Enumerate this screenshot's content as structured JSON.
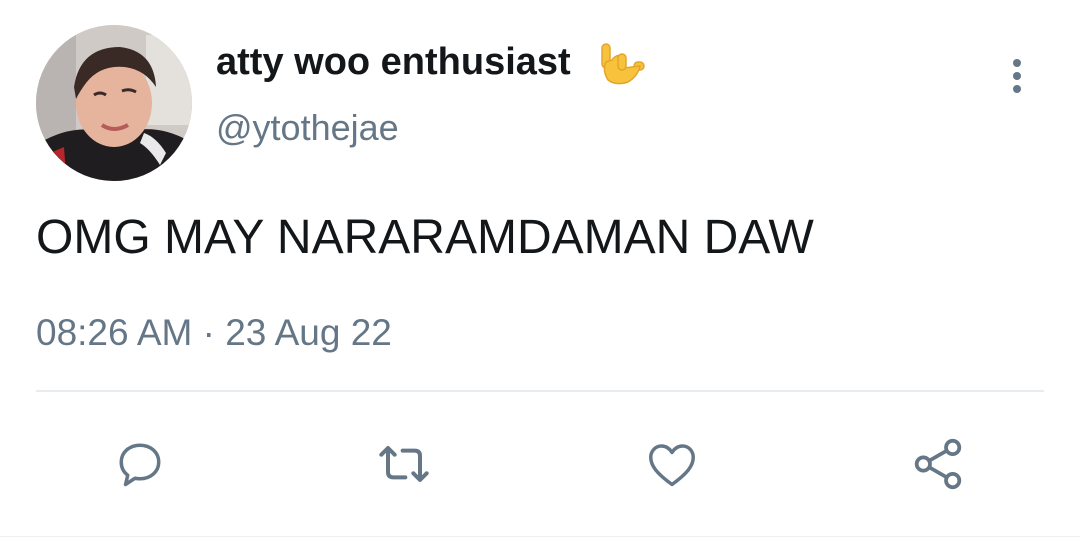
{
  "tweet": {
    "display_name": "atty woo enthusiast",
    "display_name_emoji": "🤟",
    "handle": "@ytothejae",
    "text": "OMG MAY NARARAMDAMAN DAW",
    "timestamp": "08:26 AM · 23 Aug 22"
  },
  "icons": {
    "more": "more-vertical-icon",
    "reply": "reply-icon",
    "retweet": "retweet-icon",
    "like": "heart-icon",
    "share": "share-icon"
  },
  "colors": {
    "text_primary": "#14171a",
    "text_secondary": "#657786",
    "divider": "#e6ecf0",
    "icon": "#657786"
  }
}
